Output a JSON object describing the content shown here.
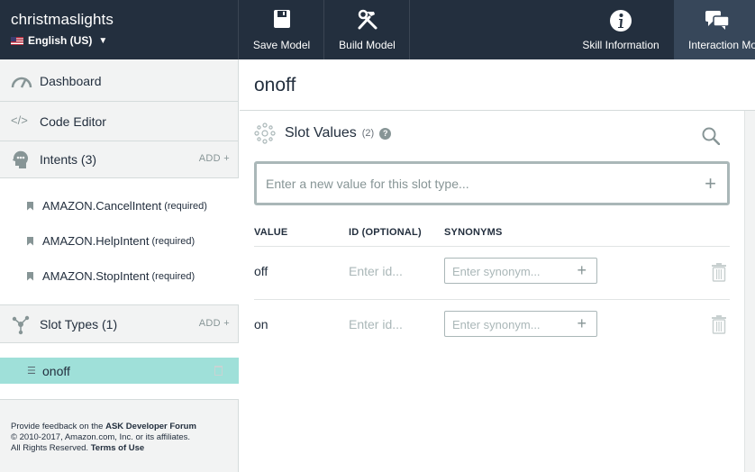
{
  "topbar": {
    "skill_name": "christmaslights",
    "locale": "English (US)",
    "buttons": {
      "save": "Save Model",
      "build": "Build Model",
      "info": "Skill Information",
      "interaction": "Interaction Model"
    }
  },
  "sidebar": {
    "dashboard": "Dashboard",
    "code_editor": "Code Editor",
    "intents_label": "Intents (3)",
    "add_label": "ADD +",
    "intents": [
      {
        "name": "AMAZON.CancelIntent",
        "note": "(required)"
      },
      {
        "name": "AMAZON.HelpIntent",
        "note": "(required)"
      },
      {
        "name": "AMAZON.StopIntent",
        "note": "(required)"
      }
    ],
    "slot_types_label": "Slot Types (1)",
    "slot_types": [
      {
        "name": "onoff"
      }
    ],
    "footer": {
      "line1_prefix": "Provide feedback on the ",
      "line1_link": "ASK Developer Forum",
      "line2": "© 2010-2017, Amazon.com, Inc. or its affiliates.",
      "line3_prefix": "All Rights Reserved. ",
      "line3_link": "Terms of Use"
    }
  },
  "main": {
    "title": "onoff",
    "slot_values_title": "Slot Values",
    "slot_values_count": "(2)",
    "new_value_placeholder": "Enter a new value for this slot type...",
    "columns": {
      "value": "VALUE",
      "id": "ID (OPTIONAL)",
      "synonyms": "SYNONYMS"
    },
    "rows": [
      {
        "value": "off",
        "id_placeholder": "Enter id...",
        "synonym_placeholder": "Enter synonym..."
      },
      {
        "value": "on",
        "id_placeholder": "Enter id...",
        "synonym_placeholder": "Enter synonym..."
      }
    ]
  },
  "colors": {
    "topbar_bg": "#232f3e",
    "selected_slot_bg": "#9fe0d9",
    "sidebar_bg": "#f2f3f3"
  }
}
